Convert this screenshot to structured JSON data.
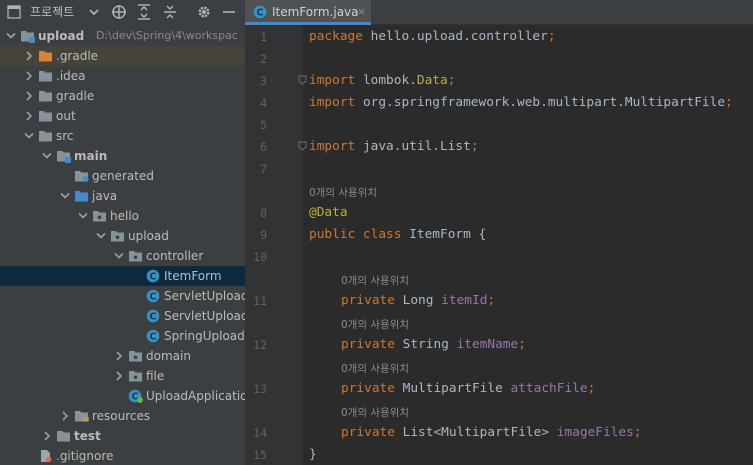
{
  "project_panel": {
    "title": "프로젝트",
    "toolbar": [
      "panel-layout-icon",
      "chevron-down-icon",
      "locate-icon",
      "expand-all-icon",
      "collapse-all-icon",
      "gear-icon",
      "minimize-icon"
    ]
  },
  "tree": [
    {
      "label": "upload",
      "path": "D:\\dev\\Spring\\4\\workspac",
      "depth": 0,
      "expanded": true,
      "icon": "module-folder-icon",
      "bold": true
    },
    {
      "label": ".gradle",
      "depth": 1,
      "expanded": false,
      "icon": "orange-folder-icon",
      "highlight": true
    },
    {
      "label": ".idea",
      "depth": 1,
      "expanded": false,
      "icon": "folder-icon"
    },
    {
      "label": "gradle",
      "depth": 1,
      "expanded": false,
      "icon": "folder-icon"
    },
    {
      "label": "out",
      "depth": 1,
      "expanded": false,
      "icon": "folder-icon"
    },
    {
      "label": "src",
      "depth": 1,
      "expanded": true,
      "icon": "folder-icon"
    },
    {
      "label": "main",
      "depth": 2,
      "expanded": true,
      "icon": "source-set-folder-icon",
      "bold": true
    },
    {
      "label": "generated",
      "depth": 3,
      "expanded": null,
      "icon": "generated-folder-icon"
    },
    {
      "label": "java",
      "depth": 3,
      "expanded": true,
      "icon": "source-root-folder-icon"
    },
    {
      "label": "hello",
      "depth": 4,
      "expanded": true,
      "icon": "package-icon"
    },
    {
      "label": "upload",
      "depth": 5,
      "expanded": true,
      "icon": "package-icon"
    },
    {
      "label": "controller",
      "depth": 6,
      "expanded": true,
      "icon": "package-icon"
    },
    {
      "label": "ItemForm",
      "depth": 7,
      "expanded": null,
      "icon": "class-icon",
      "selected": true
    },
    {
      "label": "ServletUploadC",
      "depth": 7,
      "expanded": null,
      "icon": "class-icon"
    },
    {
      "label": "ServletUploadC",
      "depth": 7,
      "expanded": null,
      "icon": "class-icon"
    },
    {
      "label": "SpringUploadC",
      "depth": 7,
      "expanded": null,
      "icon": "class-icon"
    },
    {
      "label": "domain",
      "depth": 6,
      "expanded": false,
      "icon": "package-icon"
    },
    {
      "label": "file",
      "depth": 6,
      "expanded": false,
      "icon": "package-icon"
    },
    {
      "label": "UploadApplication",
      "depth": 6,
      "expanded": null,
      "icon": "spring-class-icon"
    },
    {
      "label": "resources",
      "depth": 3,
      "expanded": false,
      "icon": "resources-folder-icon"
    },
    {
      "label": "test",
      "depth": 2,
      "expanded": false,
      "icon": "folder-icon",
      "bold": true
    },
    {
      "label": ".gitignore",
      "depth": 1,
      "expanded": null,
      "icon": "gitignore-file-icon"
    }
  ],
  "editor": {
    "tab": {
      "label": "ItemForm.java",
      "close": "×",
      "icon": "class-icon"
    },
    "hint_text": "0개의 사용위치",
    "lines": [
      {
        "kind": "code",
        "num": "1",
        "indent": 0,
        "fold": false,
        "tokens": [
          {
            "t": "package ",
            "c": "kw"
          },
          {
            "t": "hello.upload.controller",
            "c": "pl"
          },
          {
            "t": ";",
            "c": "kw"
          }
        ]
      },
      {
        "kind": "code",
        "num": "2",
        "indent": 0,
        "fold": false,
        "tokens": []
      },
      {
        "kind": "code",
        "num": "3",
        "indent": 0,
        "fold": true,
        "tokens": [
          {
            "t": "import ",
            "c": "kw"
          },
          {
            "t": "lombok.",
            "c": "pl"
          },
          {
            "t": "Data",
            "c": "an"
          },
          {
            "t": ";",
            "c": "kw"
          }
        ]
      },
      {
        "kind": "code",
        "num": "4",
        "indent": 0,
        "fold": false,
        "tokens": [
          {
            "t": "import ",
            "c": "kw"
          },
          {
            "t": "org.springframework.web.multipart.MultipartFile",
            "c": "pl"
          },
          {
            "t": ";",
            "c": "kw"
          }
        ]
      },
      {
        "kind": "code",
        "num": "5",
        "indent": 0,
        "fold": false,
        "tokens": []
      },
      {
        "kind": "code",
        "num": "6",
        "indent": 0,
        "fold": true,
        "tokens": [
          {
            "t": "import ",
            "c": "kw"
          },
          {
            "t": "java.util.List",
            "c": "pl"
          },
          {
            "t": ";",
            "c": "kw"
          }
        ]
      },
      {
        "kind": "code",
        "num": "7",
        "indent": 0,
        "fold": false,
        "tokens": []
      },
      {
        "kind": "hint",
        "indent": 0
      },
      {
        "kind": "code",
        "num": "8",
        "indent": 0,
        "fold": false,
        "tokens": [
          {
            "t": "@Data",
            "c": "an"
          }
        ]
      },
      {
        "kind": "code",
        "num": "9",
        "indent": 0,
        "fold": false,
        "tokens": [
          {
            "t": "public class ",
            "c": "kw"
          },
          {
            "t": "ItemForm {",
            "c": "pl"
          }
        ]
      },
      {
        "kind": "code",
        "num": "10",
        "indent": 0,
        "fold": false,
        "tokens": []
      },
      {
        "kind": "hint",
        "indent": 1
      },
      {
        "kind": "code",
        "num": "11",
        "indent": 1,
        "fold": false,
        "tokens": [
          {
            "t": "private ",
            "c": "kw"
          },
          {
            "t": "Long ",
            "c": "pl"
          },
          {
            "t": "itemId",
            "c": "fd"
          },
          {
            "t": ";",
            "c": "kw"
          }
        ]
      },
      {
        "kind": "hint",
        "indent": 1
      },
      {
        "kind": "code",
        "num": "12",
        "indent": 1,
        "fold": false,
        "tokens": [
          {
            "t": "private ",
            "c": "kw"
          },
          {
            "t": "String ",
            "c": "pl"
          },
          {
            "t": "itemName",
            "c": "fd"
          },
          {
            "t": ";",
            "c": "kw"
          }
        ]
      },
      {
        "kind": "hint",
        "indent": 1
      },
      {
        "kind": "code",
        "num": "13",
        "indent": 1,
        "fold": false,
        "tokens": [
          {
            "t": "private ",
            "c": "kw"
          },
          {
            "t": "MultipartFile ",
            "c": "pl"
          },
          {
            "t": "attachFile",
            "c": "fd"
          },
          {
            "t": ";",
            "c": "kw"
          }
        ]
      },
      {
        "kind": "hint",
        "indent": 1
      },
      {
        "kind": "code",
        "num": "14",
        "indent": 1,
        "fold": false,
        "tokens": [
          {
            "t": "private ",
            "c": "kw"
          },
          {
            "t": "List<MultipartFile> ",
            "c": "pl"
          },
          {
            "t": "imageFiles",
            "c": "fd"
          },
          {
            "t": ";",
            "c": "kw"
          }
        ]
      },
      {
        "kind": "code",
        "num": "15",
        "indent": 0,
        "fold": false,
        "tokens": [
          {
            "t": "}",
            "c": "pl"
          }
        ]
      }
    ]
  },
  "colors": {
    "panel_bg": "#3c3f41",
    "editor_bg": "#2b2b2b",
    "selection": "#0d293e",
    "keyword": "#cc7832",
    "annotation": "#bbb529",
    "field": "#9876aa",
    "plain": "#a9b7c6"
  }
}
